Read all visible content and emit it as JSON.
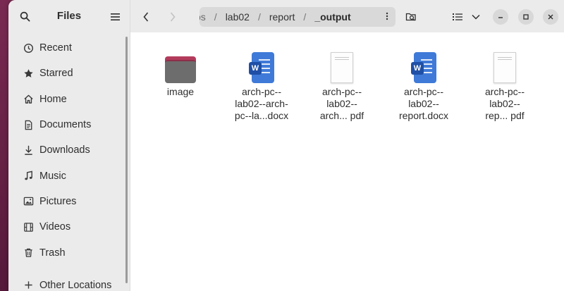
{
  "app": {
    "title": "Files"
  },
  "sidebar": {
    "items": [
      {
        "label": "Recent",
        "icon": "clock-icon"
      },
      {
        "label": "Starred",
        "icon": "star-icon"
      },
      {
        "label": "Home",
        "icon": "home-icon"
      },
      {
        "label": "Documents",
        "icon": "document-icon"
      },
      {
        "label": "Downloads",
        "icon": "download-icon"
      },
      {
        "label": "Music",
        "icon": "music-icon"
      },
      {
        "label": "Pictures",
        "icon": "picture-icon"
      },
      {
        "label": "Videos",
        "icon": "video-icon"
      },
      {
        "label": "Trash",
        "icon": "trash-icon"
      }
    ],
    "other_locations": "Other Locations"
  },
  "pathbar": {
    "crumbs": [
      "os",
      "lab02",
      "report",
      "_output"
    ]
  },
  "files": [
    {
      "name": "image",
      "type": "folder"
    },
    {
      "name": "arch-pc--\nlab02--arch-\npc--la...docx",
      "type": "docx"
    },
    {
      "name": "arch-pc--\nlab02--\narch... pdf",
      "type": "pdf"
    },
    {
      "name": "arch-pc--\nlab02--\nreport.docx",
      "type": "docx"
    },
    {
      "name": "arch-pc--\nlab02--\nrep...  pdf",
      "type": "pdf"
    }
  ],
  "colors": {
    "folder_accent": "#b33b5c",
    "docx_blue": "#3f7ad8",
    "desktop": "#5b1a3e"
  }
}
